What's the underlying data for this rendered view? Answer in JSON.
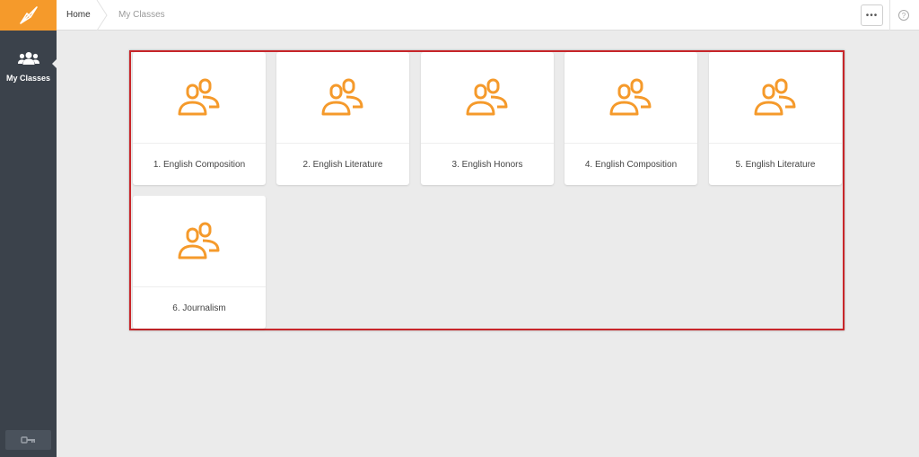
{
  "colors": {
    "accent": "#f59a2b",
    "sidebar": "#3b424b",
    "highlight": "#c8262a"
  },
  "sidebar": {
    "logo_icon": "compass-icon",
    "items": [
      {
        "label": "My Classes",
        "icon": "users-icon",
        "active": true
      }
    ],
    "logout_icon": "key-icon"
  },
  "topbar": {
    "breadcrumb": {
      "home": "Home",
      "current": "My Classes"
    },
    "more_label": "•••",
    "help_label": "?"
  },
  "classes": [
    {
      "label": "1. English Composition",
      "icon": "group-icon"
    },
    {
      "label": "2. English Literature",
      "icon": "group-icon"
    },
    {
      "label": "3. English Honors",
      "icon": "group-icon"
    },
    {
      "label": "4. English Composition",
      "icon": "group-icon"
    },
    {
      "label": "5. English Literature",
      "icon": "group-icon"
    },
    {
      "label": "6. Journalism",
      "icon": "group-icon"
    }
  ]
}
